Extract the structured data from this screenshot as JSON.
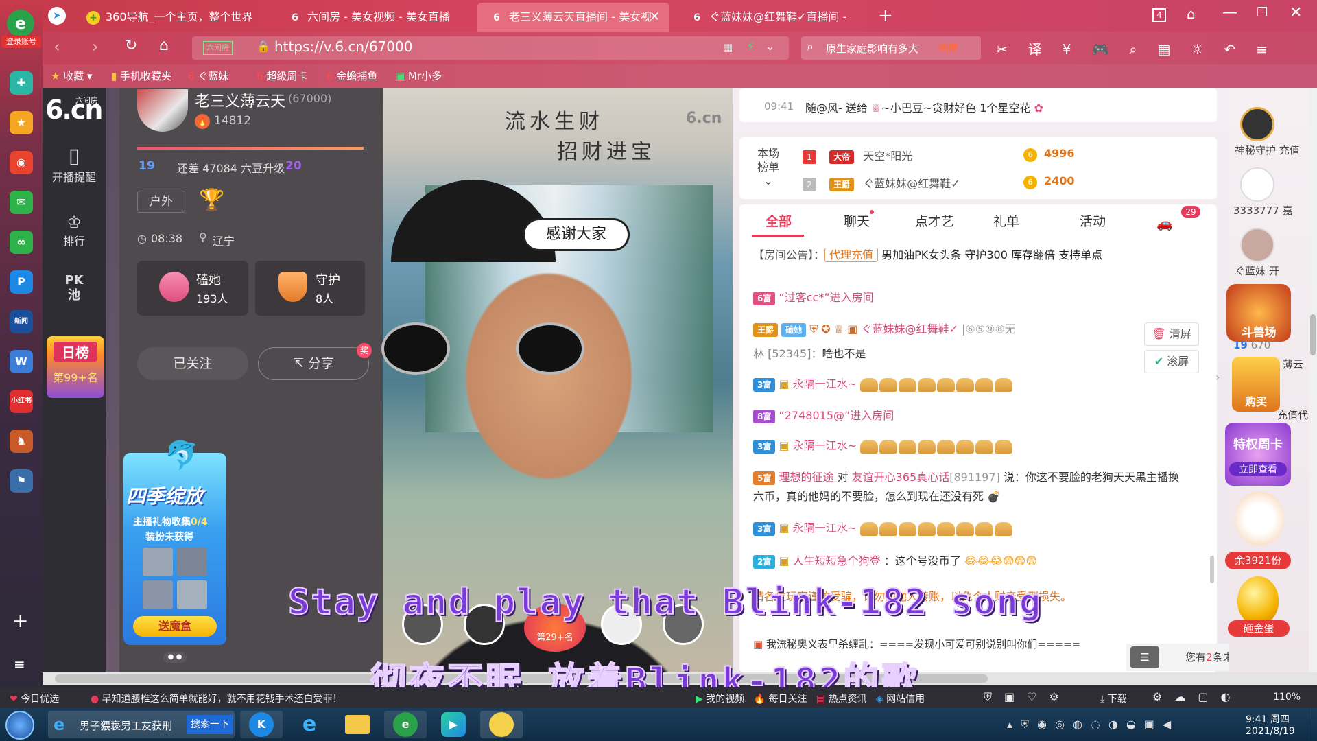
{
  "browser": {
    "login_badge": "登录账号",
    "tabs": [
      {
        "label": "360导航_一个主页，整个世界"
      },
      {
        "label": "六间房 - 美女视频 - 美女直播"
      },
      {
        "label": "老三义薄云天直播间 - 美女视"
      },
      {
        "label": "ぐ蓝妹妹@红舞鞋✓直播间 -"
      }
    ],
    "tab_count": "4",
    "url": "https://v.6.cn/67000",
    "url_site_tag": "六间房",
    "search_text": "原生家庭影响有多大",
    "search_hot": "热搜",
    "bookmarks": [
      "收藏",
      "手机收藏夹",
      "ぐ蓝妹",
      "超级周卡",
      "金蟾捕鱼",
      "Mr小多"
    ]
  },
  "nav": {
    "logo": "6.cn",
    "logo_small": "六间房",
    "items": [
      {
        "label": "开播提醒"
      },
      {
        "label": "排行"
      },
      {
        "label": "PK池"
      }
    ],
    "daily_rank_label": "日榜",
    "daily_rank_value": "第99+名"
  },
  "anchor": {
    "name": "老三义薄云天",
    "room_id": "(67000)",
    "hot": "14812",
    "level_from": "19",
    "level_to": "20",
    "level_text": "还差 47084 六豆升级",
    "category": "户外",
    "time": "08:38",
    "location": "辽宁",
    "fans_label": "磕她",
    "fans_count": "193人",
    "guard_label": "守护",
    "guard_count": "8人",
    "follow_label": "已关注",
    "share_label": "分享",
    "share_badge": "奖",
    "promo_title": "四季绽放",
    "promo_line1_prefix": "主播礼物收集",
    "promo_line1_count": "0/4",
    "promo_line2": "装扮未获得",
    "promo_btn": "送魔盒"
  },
  "video": {
    "watermark_line1": "流水生财",
    "watermark_line2": "招财进宝",
    "watermark_logo": "6.cn",
    "bubble": "感谢大家",
    "rank_badge": "第29+名"
  },
  "subtitles": {
    "en": "Stay and play that Blink-182 song",
    "zh": "彻夜不眠 放着Blink-182的歌"
  },
  "chat": {
    "top_time": "09:41",
    "top_msg_user": "随@风",
    "top_msg_text": "送给",
    "top_msg_target": "~小巴豆~贪财好色",
    "top_msg_gift": "1个星空花",
    "rank_label_1": "本场",
    "rank_label_2": "榜单",
    "rank": [
      {
        "pos": "1",
        "title": "大帝",
        "name": "天空*阳光",
        "value": "4996"
      },
      {
        "pos": "2",
        "title": "王爵",
        "name": "ぐ蓝妹妹@红舞鞋✓",
        "value": "2400"
      }
    ],
    "tabs": [
      "全部",
      "聊天",
      "点才艺",
      "礼单",
      "活动"
    ],
    "car_badge": "29",
    "notice_label": "【房间公告】：",
    "notice_tag": "代理充值",
    "notice_text": "男加油PK女头条 守护300 库存翻倍 支持单点",
    "clear_label": "清屏",
    "scroll_label": "滚屏",
    "messages": [
      {
        "lvl": "6富",
        "cls": "lv6",
        "text": "“过客cc*”进入房间"
      },
      {
        "lvl": "王爵",
        "cls": "lv5",
        "text": "ぐ蓝妹妹@红舞鞋✓",
        "extra": "|⑥⑤⑨⑧无",
        "sub": "林 [52345]：",
        "subtext": "啥也不是",
        "fan": "磕她"
      },
      {
        "lvl": "3富",
        "cls": "lv3",
        "text": "永隔一江水~"
      },
      {
        "lvl": "8富",
        "cls": "lv8",
        "text": "“2748015@”进入房间"
      },
      {
        "lvl": "3富",
        "cls": "lv3",
        "text": "永隔一江水~"
      },
      {
        "lvl": "5富",
        "cls": "lv5",
        "text": "理想的征途",
        "mid": "对",
        "target": "友谊开心365真心话",
        "target_id": "[891197]",
        "say": "说：你这不要脸的老狗天天黑主播换",
        "line2": "六币，真的他妈的不要脸，怎么到现在还没有死"
      },
      {
        "lvl": "3富",
        "cls": "lv3",
        "text": "永隔一江水~"
      },
      {
        "lvl": "2富",
        "cls": "lv2",
        "text": "人生短短急个狗登",
        "say": "：这个号没币了"
      }
    ],
    "warning": "请各位玩家谨防受骗，请勿向他人转账，以免个人财产受到损失。",
    "bottom_msg": "我流秘奥义表里杀缠乱：====发现小可爱可别说别叫你们=====",
    "unread_prefix": "您有",
    "unread_count": "2",
    "unread_suffix": "条未读消息"
  },
  "right": {
    "guard_1": "神秘守护",
    "guard_1b": "充值",
    "guard_2": "3333777",
    "guard_2b": "嘉",
    "guard_3": "ぐ蓝妹",
    "guard_3b": "开",
    "promo_1": "斗兽场",
    "promo_1_lvl": "19",
    "promo_1_num": "670",
    "promo_1_text": "薄云",
    "promo_2": "购买",
    "promo_2_text": "充值代",
    "promo_3": "特权周卡",
    "promo_3_btn": "立即查看",
    "promo_4": "余3921份",
    "promo_5": "砸金蛋"
  },
  "statusbar": {
    "left1": "今日优选",
    "left2": "早知道腰椎这么简单就能好，就不用花钱手术还白受罪！",
    "items": [
      "我的视频",
      "每日关注",
      "热点资讯",
      "网站信用",
      "下载"
    ],
    "zoom": "110%"
  },
  "taskbar": {
    "task1": "男子猥亵男工友获刑",
    "task1_btn": "搜索一下",
    "time": "9:41 周四",
    "date": "2021/8/19"
  }
}
